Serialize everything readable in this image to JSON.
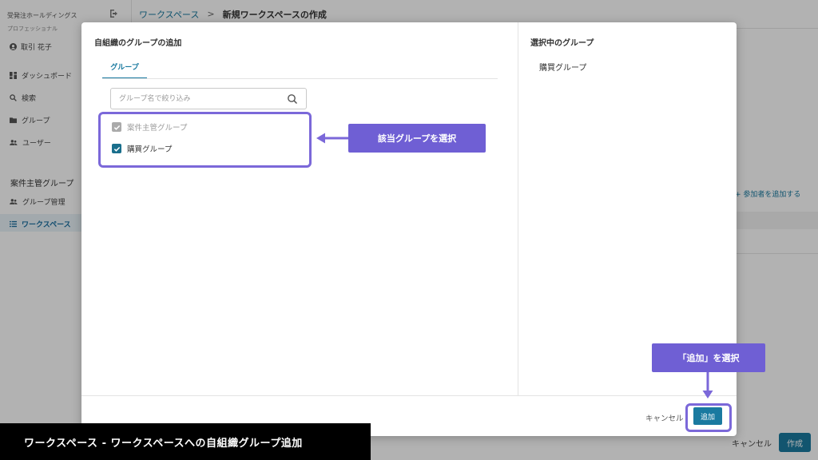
{
  "sidebar": {
    "org_name": "受発注ホールディングス",
    "plan": "プロフェッショナル",
    "user_name": "取引 花子",
    "items": [
      {
        "label": "ダッシュボード",
        "icon": "dashboard-icon"
      },
      {
        "label": "検索",
        "icon": "search-icon"
      },
      {
        "label": "グループ",
        "icon": "folder-icon"
      },
      {
        "label": "ユーザー",
        "icon": "users-icon"
      }
    ],
    "section_title": "案件主管グループ",
    "sub_items": [
      {
        "label": "グループ管理",
        "icon": "users-icon"
      },
      {
        "label": "ワークスペース",
        "icon": "list-icon",
        "active": true
      }
    ]
  },
  "breadcrumb": {
    "link": "ワークスペース",
    "separator": ">",
    "current": "新規ワークスペースの作成"
  },
  "background": {
    "add_member_label": "+ 参加者を追加する",
    "cancel_label": "キャンセル",
    "create_label": "作成"
  },
  "modal": {
    "title": "自組織のグループの追加",
    "tab_label": "グループ",
    "search_placeholder": "グループ名で絞り込み",
    "groups": [
      {
        "label": "案件主管グループ",
        "checked": true,
        "disabled": true
      },
      {
        "label": "購買グループ",
        "checked": true,
        "disabled": false
      }
    ],
    "selected_title": "選択中のグループ",
    "selected_groups": [
      "購買グループ"
    ],
    "cancel_label": "キャンセル",
    "add_label": "追加"
  },
  "annotations": {
    "select_group": "該当グループを選択",
    "click_add": "「追加」を選択",
    "highlight_color": "#7b68d9",
    "callout_color": "#6f5fd4"
  },
  "caption": "ワークスペース - ワークスペースへの自組織グループ追加",
  "colors": {
    "accent": "#1a7aa0",
    "checkbox_checked": "#1a6f8c",
    "checkbox_disabled": "#aaaaaa"
  }
}
